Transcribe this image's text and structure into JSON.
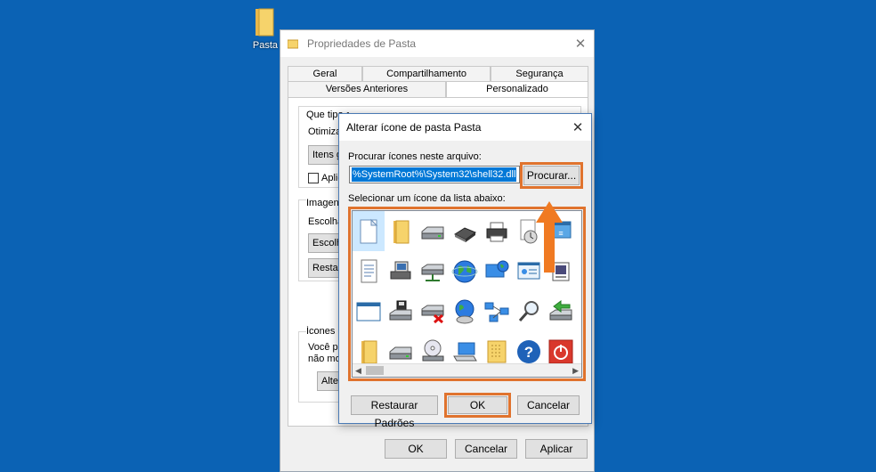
{
  "desktop": {
    "folder_label": "Pasta"
  },
  "props": {
    "title": "Propriedades de Pasta",
    "tabs_row1": [
      "Geral",
      "Compartilhamento",
      "Segurança"
    ],
    "tabs_row2": [
      "Versões Anteriores",
      "Personalizado"
    ],
    "frag_question": "Que tipo de pasta você quer?",
    "frag_optimize": "Otimizar",
    "frag_items": "Itens g",
    "frag_apply": "Aplic",
    "frag_images": "Imagens",
    "frag_choose": "Escolha",
    "frag_choose_btn": "Escolh",
    "frag_restore_btn": "Restau",
    "frag_icons": "Ícones d",
    "frag_you_can": "Você po",
    "frag_not_show": "não mos",
    "frag_alter_btn": "Alterar",
    "ok": "OK",
    "cancel": "Cancelar",
    "apply": "Aplicar"
  },
  "dialog": {
    "title": "Alterar ícone de pasta Pasta",
    "search_label": "Procurar ícones neste arquivo:",
    "path_value": "%SystemRoot%\\System32\\shell32.dll",
    "browse": "Procurar...",
    "list_label": "Selecionar um ícone da lista abaixo:",
    "restore_defaults": "Restaurar Padrões",
    "ok": "OK",
    "cancel": "Cancelar"
  },
  "icons": [
    [
      "blank-file-icon",
      "folder-icon",
      "drive-icon",
      "chip-icon",
      "printer-icon",
      "clock-icon",
      "window-icon",
      "partial-icon"
    ],
    [
      "document-icon",
      "computer-icon",
      "network-drive-icon",
      "globe-icon",
      "monitor-globe-icon",
      "display-settings-icon",
      "system-icon",
      "shortcut-icon"
    ],
    [
      "window-frame-icon",
      "floppy-drive-icon",
      "network-disconnect-icon",
      "globe-dish-icon",
      "network-icon",
      "magnifier-icon",
      "arrow-drive-icon",
      "misc-icon"
    ],
    [
      "folder-icon",
      "drive-icon",
      "cd-drive-icon",
      "laptop-icon",
      "folder-grid-icon",
      "help-icon",
      "power-icon",
      "partial-icon"
    ]
  ],
  "colors": {
    "desktop": "#0b62b4",
    "highlight": "#e0732e",
    "selection": "#0078d7"
  }
}
